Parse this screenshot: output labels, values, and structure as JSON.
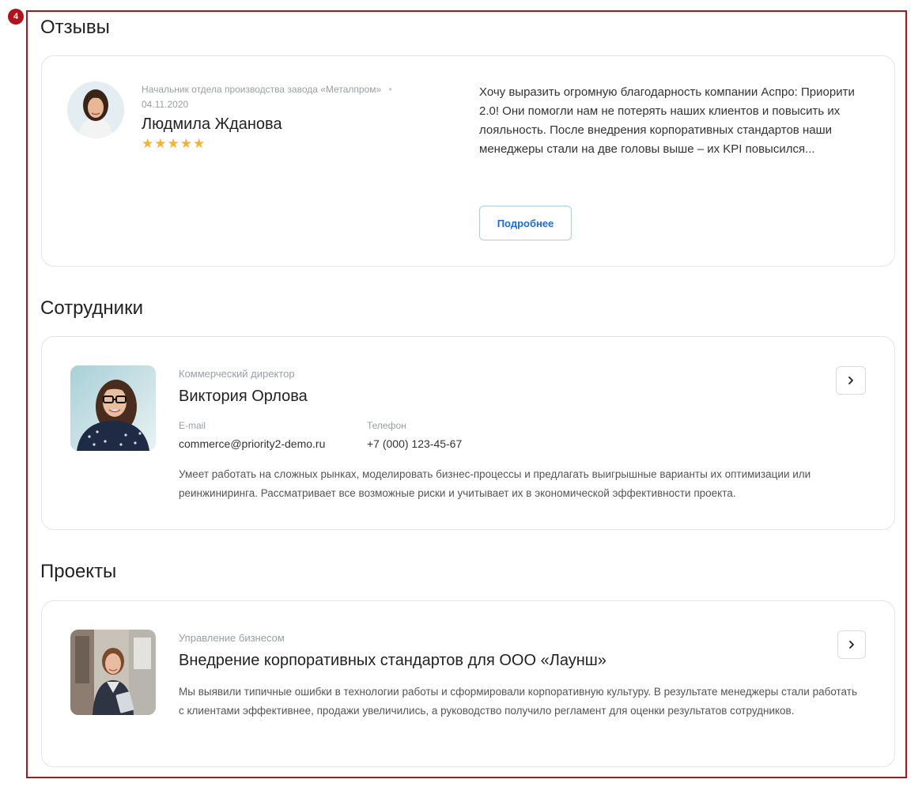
{
  "badge": "4",
  "reviews": {
    "title": "Отзывы",
    "author_position": "Начальник отдела производства завода «Металпром»",
    "date": "04.11.2020",
    "author_name": "Людмила Жданова",
    "rating": "★★★★★",
    "text": "Хочу выразить огромную благодарность компании Аспро: Приорити 2.0! Они помогли нам не потерять наших клиентов и повысить их лояльность. После внедрения корпоративных стандартов наши менеджеры стали на две головы выше – их KPI повысился...",
    "more_label": "Подробнее"
  },
  "employees": {
    "title": "Сотрудники",
    "position": "Коммерческий директор",
    "name": "Виктория Орлова",
    "email_label": "E-mail",
    "email": "commerce@priority2-demo.ru",
    "phone_label": "Телефон",
    "phone": "+7 (000) 123-45-67",
    "description": "Умеет работать на сложных рынках, моделировать бизнес-процессы и предлагать выигрышные варианты их оптимизации или реинжиниринга. Рассматривает все возможные риски и учитывает их в экономической эффективности проекта."
  },
  "projects": {
    "title": "Проекты",
    "category": "Управление бизнесом",
    "name": "Внедрение корпоративных стандартов для ООО «Лаунш»",
    "description": "Мы выявили типичные ошибки в технологии работы и сформировали корпоративную культуру. В результате менеджеры стали работать с клиентами эффективнее, продажи увеличились, а руководство получило регламент для оценки результатов сотрудников."
  },
  "colors": {
    "frame": "#b0141b",
    "accent": "#1b6ed6",
    "stars": "#f5b335"
  },
  "icons": {
    "arrow": "chevron-right-icon",
    "rating": "star-icon"
  }
}
